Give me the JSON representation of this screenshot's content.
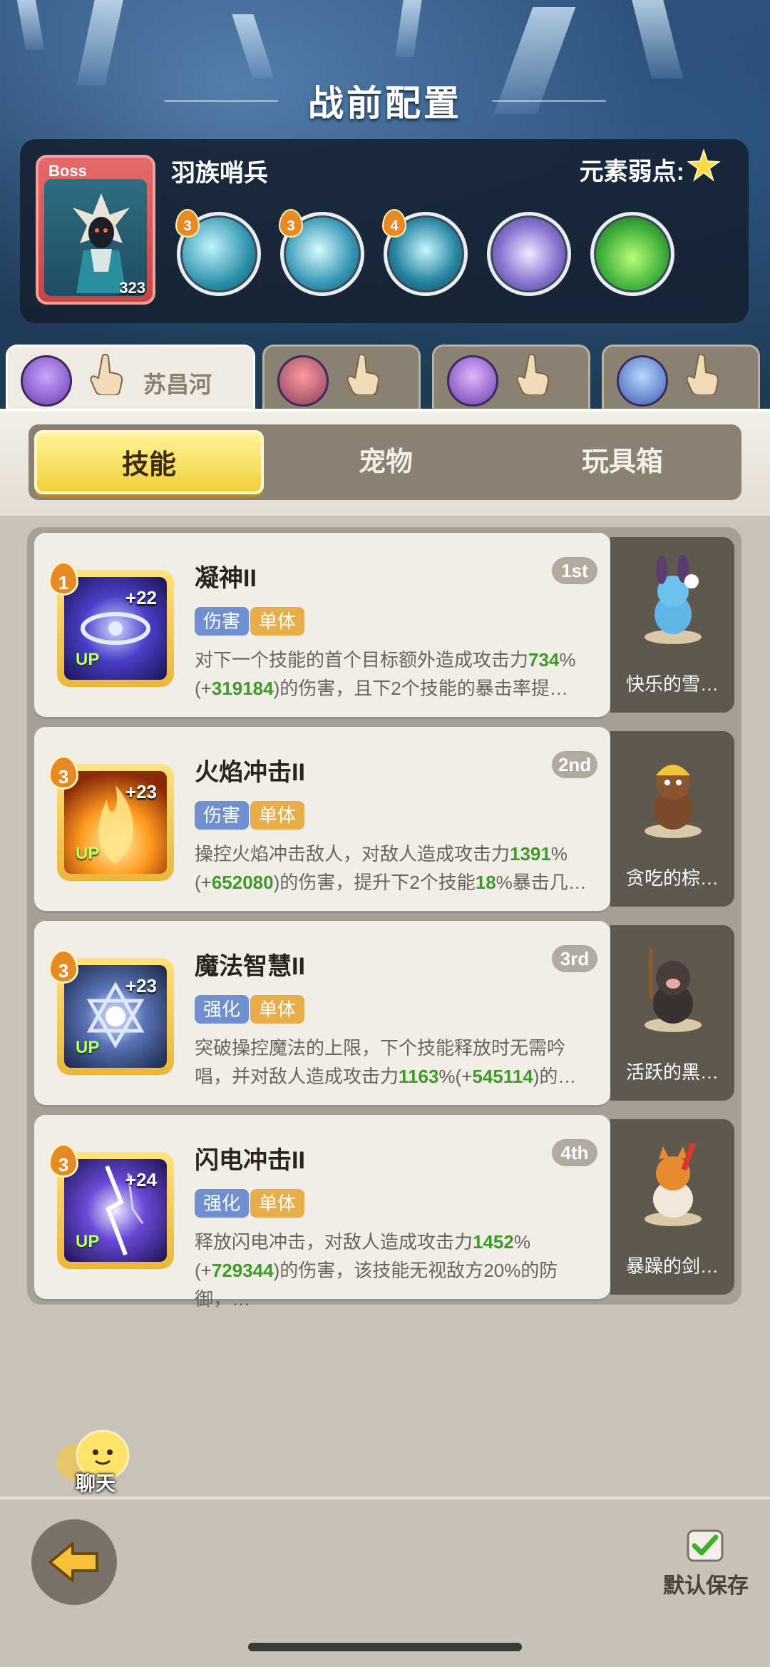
{
  "header": {
    "title": "战前配置"
  },
  "boss": {
    "tag": "Boss",
    "level": "323",
    "name": "羽族哨兵",
    "weakness_label": "元素弱点:",
    "weakness_icon": "light-star-icon",
    "skills": [
      {
        "level": "3",
        "icon": "ice-spear-icon"
      },
      {
        "level": "3",
        "icon": "ice-shatter-icon"
      },
      {
        "level": "4",
        "icon": "ice-lance-icon"
      },
      {
        "level": "",
        "icon": "wind-swirl-icon"
      },
      {
        "level": "",
        "icon": "poison-slime-icon"
      }
    ]
  },
  "heroes": [
    {
      "name": "苏昌河",
      "active": true
    },
    {
      "name": "",
      "active": false
    },
    {
      "name": "",
      "active": false
    },
    {
      "name": "",
      "active": false
    }
  ],
  "tabs": [
    {
      "label": "技能",
      "active": true
    },
    {
      "label": "宠物",
      "active": false
    },
    {
      "label": "玩具箱",
      "active": false
    }
  ],
  "skills": [
    {
      "name": "凝神II",
      "order": "1st",
      "level": "1",
      "bonus": "+22",
      "up": "UP",
      "tags": [
        "伤害",
        "单体"
      ],
      "desc": [
        {
          "t": "对下一个技能的首个目标额外造成攻击力"
        },
        {
          "t": "734",
          "g": true
        },
        {
          "t": "%(+"
        },
        {
          "t": "319184",
          "g": true
        },
        {
          "t": ")的伤害，且下2个技能的暴击率提…"
        }
      ],
      "pet": "快乐的雪…"
    },
    {
      "name": "火焰冲击II",
      "order": "2nd",
      "level": "3",
      "bonus": "+23",
      "up": "UP",
      "tags": [
        "伤害",
        "单体"
      ],
      "desc": [
        {
          "t": "操控火焰冲击敌人，对敌人造成攻击力"
        },
        {
          "t": "1391",
          "g": true
        },
        {
          "t": "%(+"
        },
        {
          "t": "652080",
          "g": true
        },
        {
          "t": ")的伤害，提升下2个技能"
        },
        {
          "t": "18",
          "g": true
        },
        {
          "t": "%暴击几…"
        }
      ],
      "pet": "贪吃的棕…"
    },
    {
      "name": "魔法智慧II",
      "order": "3rd",
      "level": "3",
      "bonus": "+23",
      "up": "UP",
      "tags": [
        "强化",
        "单体"
      ],
      "desc": [
        {
          "t": "突破操控魔法的上限，下个技能释放时无需吟唱，并对敌人造成攻击力"
        },
        {
          "t": "1163",
          "g": true
        },
        {
          "t": "%(+"
        },
        {
          "t": "545114",
          "g": true
        },
        {
          "t": ")的…"
        }
      ],
      "pet": "活跃的黑…"
    },
    {
      "name": "闪电冲击II",
      "order": "4th",
      "level": "3",
      "bonus": "+24",
      "up": "UP",
      "tags": [
        "强化",
        "单体"
      ],
      "desc": [
        {
          "t": "释放闪电冲击，对敌人造成攻击力"
        },
        {
          "t": "1452",
          "g": true
        },
        {
          "t": "%(+"
        },
        {
          "t": "729344",
          "g": true
        },
        {
          "t": ")的伤害，该技能无视敌方20%的防御，…"
        }
      ],
      "pet": "暴躁的剑…"
    }
  ],
  "footer": {
    "chat_label": "聊天",
    "save_label": "默认保存"
  },
  "colors": {
    "accent_yellow": "#f2cf3c",
    "value_green": "#3f9a2a",
    "panel_dark": "#5f584f"
  }
}
